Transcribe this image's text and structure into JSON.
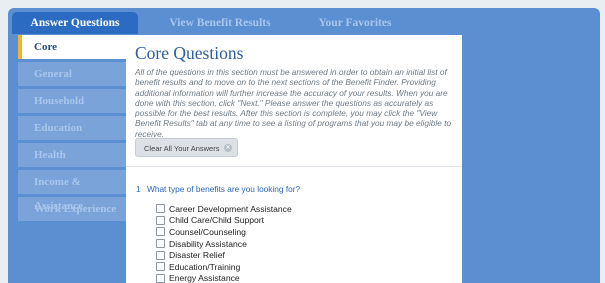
{
  "tabs": [
    "Answer Questions",
    "View Benefit Results",
    "Your Favorites"
  ],
  "sidebar": {
    "items": [
      {
        "label": "Core",
        "active": true
      },
      {
        "label": "General",
        "active": false
      },
      {
        "label": "Household",
        "active": false
      },
      {
        "label": "Education",
        "active": false
      },
      {
        "label": "Health",
        "active": false
      },
      {
        "label": "Income & Assistance",
        "active": false
      },
      {
        "label": "Work Experience",
        "active": false
      }
    ]
  },
  "main": {
    "title": "Core Questions",
    "intro": "All of the questions in this section must be answered in order to obtain an initial list of benefit results and to move on to the next sections of the Benefit Finder. Providing additional information will further increase the accuracy of your results. When you are done with this section, click \"Next.\" Please answer the questions as accurately as possible for the best results. After this section is complete, you may click the \"View Benefit Results\" tab at any time to see a listing of programs that you may be eligible to receive.",
    "clear_button": "Clear All Your Answers",
    "question": {
      "number": "1",
      "text": "What type of benefits are you looking for?",
      "options": [
        "Career Development Assistance",
        "Child Care/Child Support",
        "Counsel/Counseling",
        "Disability Assistance",
        "Disaster Relief",
        "Education/Training",
        "Energy Assistance"
      ]
    }
  },
  "colors": {
    "frame": "#5b8fd2",
    "active_tab": "#2b6cc2",
    "accent": "#f4b32a"
  }
}
